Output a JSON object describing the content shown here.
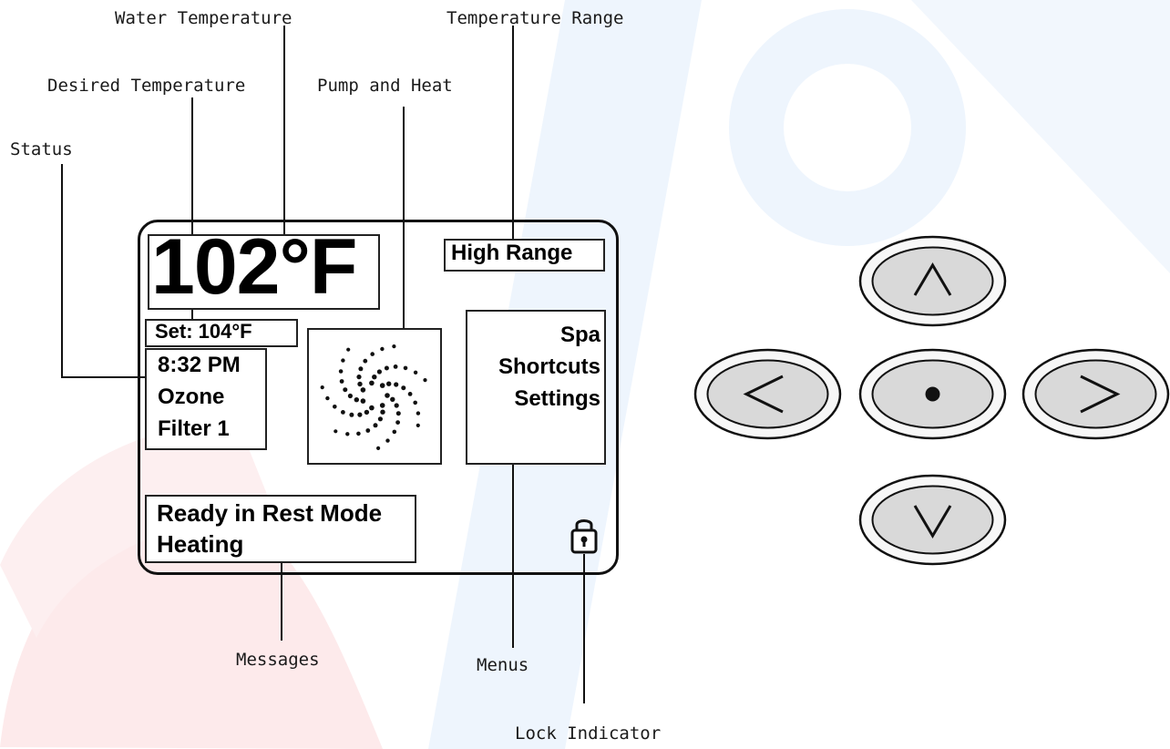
{
  "callouts": {
    "water_temperature": "Water Temperature",
    "temperature_range": "Temperature Range",
    "desired_temperature": "Desired Temperature",
    "pump_and_heat": "Pump and Heat",
    "status": "Status",
    "messages": "Messages",
    "menus": "Menus",
    "lock_indicator": "Lock Indicator"
  },
  "display": {
    "water_temp": "102°F",
    "set_temp": "Set: 104°F",
    "range": "High Range",
    "status_lines": [
      "8:32 PM",
      "Ozone",
      "Filter 1"
    ],
    "menu_items": [
      "Spa",
      "Shortcuts",
      "Settings"
    ],
    "messages": [
      "Ready in Rest Mode",
      "Heating"
    ]
  },
  "icons": {
    "pump_heat": "pump-spinner-icon",
    "lock": "lock-icon"
  },
  "buttons": {
    "up": "chevron-up-icon",
    "left": "chevron-left-icon",
    "center": "dot-icon",
    "right": "chevron-right-icon",
    "down": "chevron-down-icon"
  },
  "colors": {
    "watermark_blue": "#eef5fd",
    "watermark_red": "#fde9ea",
    "button_outer": "#f7f7f7",
    "button_inner": "#d9d9d9"
  }
}
